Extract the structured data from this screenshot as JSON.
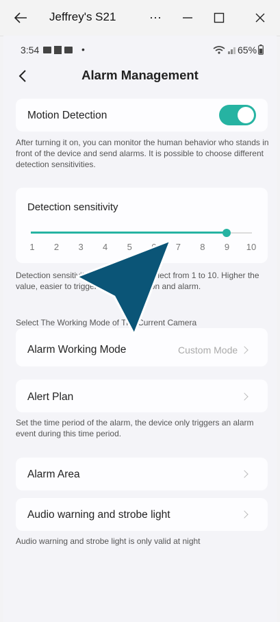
{
  "window": {
    "title": "Jeffrey's S21",
    "more_label": "⋯"
  },
  "status_bar": {
    "time": "3:54",
    "dot": "•",
    "battery": "65%"
  },
  "header": {
    "title": "Alarm Management"
  },
  "motion_detection": {
    "label": "Motion Detection",
    "enabled": true,
    "description": "After turning it on, you can monitor the human behavior who stands in front of the device and send alarms. It is possible to choose different detection sensitivities."
  },
  "sensitivity": {
    "label": "Detection sensitivity",
    "ticks": [
      "1",
      "2",
      "3",
      "4",
      "5",
      "6",
      "7",
      "8",
      "9",
      "10"
    ],
    "value": 9,
    "min": 1,
    "max": 10,
    "description": "Detection sensitivity supports you to select from 1 to 10. Higher the value, easier to trigger motion detection and alarm."
  },
  "working_mode": {
    "section_label": "Select The Working Mode of The Current Camera",
    "label": "Alarm Working Mode",
    "value": "Custom Mode"
  },
  "alert_plan": {
    "label": "Alert Plan",
    "description": "Set the time period of the alarm, the device only triggers an alarm event during this time period."
  },
  "alarm_area": {
    "label": "Alarm Area"
  },
  "audio_warning": {
    "label": "Audio warning and strobe light",
    "description": "Audio warning and strobe light is only valid at night"
  },
  "colors": {
    "accent": "#26b3a2",
    "cursor": "#0b5577"
  }
}
